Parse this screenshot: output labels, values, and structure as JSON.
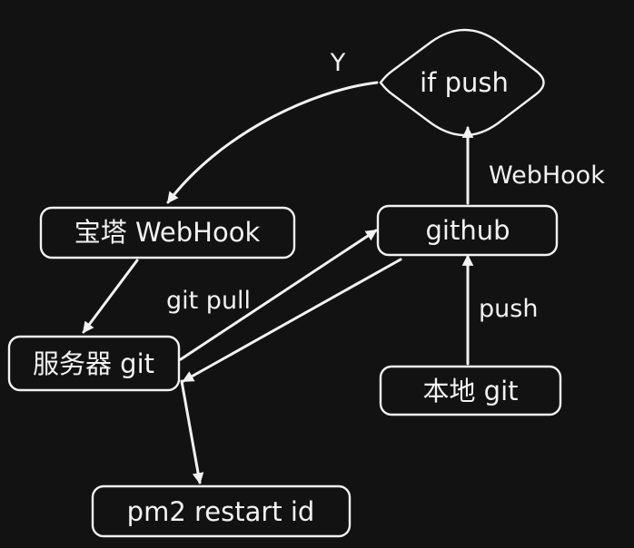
{
  "colors": {
    "background": "#121212",
    "foreground": "#f2f2f2"
  },
  "nodes": {
    "if_push": "if push",
    "baota_webhook": "宝塔 WebHook",
    "github": "github",
    "server_git": "服务器 git",
    "local_git": "本地 git",
    "pm2_restart": "pm2 restart id"
  },
  "edge_labels": {
    "yes": "Y",
    "webhook": "WebHook",
    "git_pull": "git pull",
    "push": "push"
  }
}
